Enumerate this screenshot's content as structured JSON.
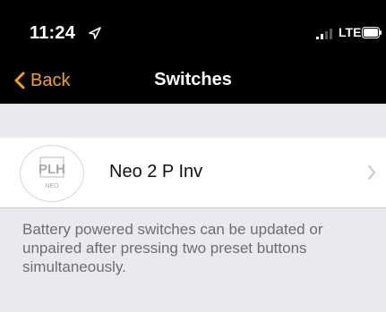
{
  "status": {
    "time": "11:24",
    "location_icon": "location-arrow-icon",
    "signal_icon": "cellular-signal-icon",
    "carrier": "LTE",
    "battery_icon": "battery-icon"
  },
  "nav": {
    "back_label": "Back",
    "title": "Switches",
    "accent": "#f7a300"
  },
  "devices": [
    {
      "label": "Neo 2 P Inv",
      "logo_text": "PLH",
      "logo_subtext": "NEO",
      "icon": "chevron-right-icon"
    }
  ],
  "footer_note": "Battery powered switches can be updated or unpaired after pressing two preset buttons simultaneously."
}
